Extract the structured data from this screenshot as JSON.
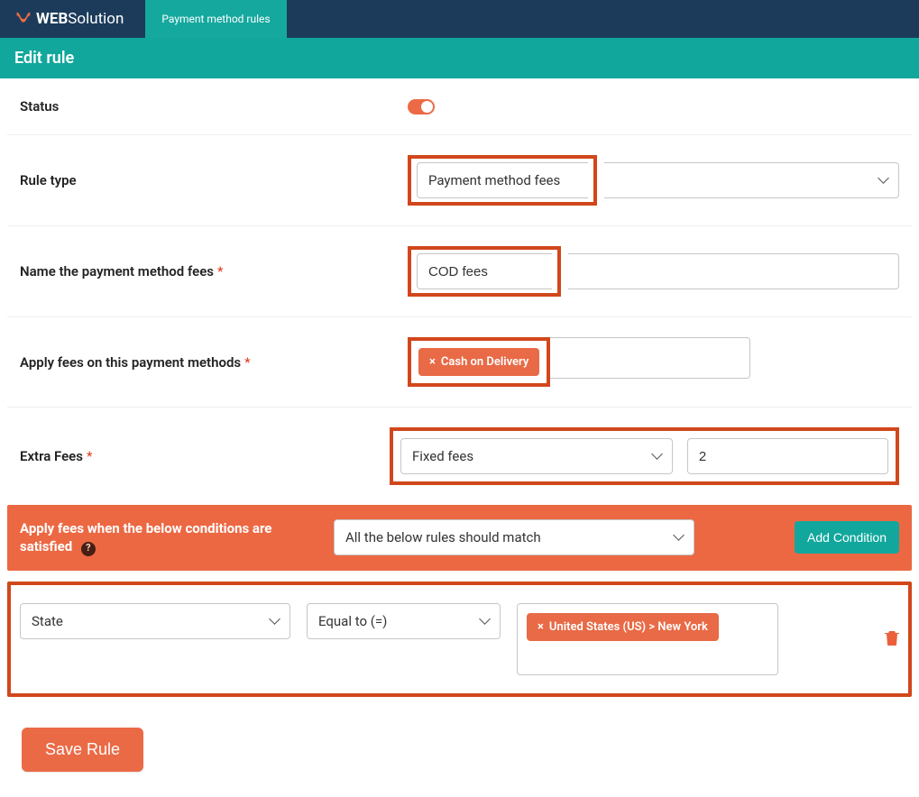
{
  "header": {
    "logo_bold": "WEB",
    "logo_thin": "Solution",
    "tab": "Payment method rules"
  },
  "page_title": "Edit rule",
  "rows": {
    "status": {
      "label": "Status"
    },
    "rule_type": {
      "label": "Rule type",
      "value": "Payment method fees"
    },
    "name_fees": {
      "label": "Name the payment method fees",
      "value": "COD fees"
    },
    "apply_methods": {
      "label": "Apply fees on this payment methods",
      "chip": "Cash on Delivery"
    },
    "extra_fees": {
      "label": "Extra Fees",
      "type": "Fixed fees",
      "amount": "2"
    }
  },
  "conditions": {
    "header_label": "Apply fees when the below conditions are satisfied",
    "match_mode": "All the below rules should match",
    "add_button": "Add Condition",
    "items": [
      {
        "field": "State",
        "operator": "Equal to (=)",
        "value_chip": "United States (US) > New York"
      }
    ]
  },
  "footer": {
    "save": "Save Rule"
  }
}
